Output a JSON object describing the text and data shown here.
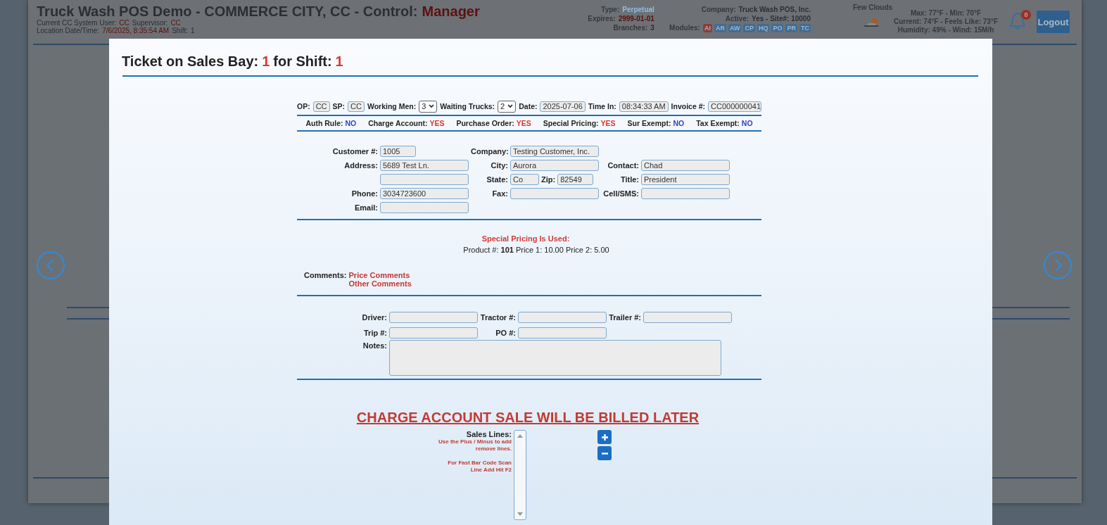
{
  "header": {
    "title": "Truck Wash POS Demo - COMMERCE CITY, CC - Control:",
    "role": "Manager",
    "user_lines": [
      [
        {
          "label": "Current CC System User:",
          "value": "CC",
          "kind": "alert"
        },
        {
          "label": "Supervisor:",
          "value": "CC",
          "kind": "alert"
        }
      ],
      [
        {
          "label": "Location Date/Time:",
          "value": "7/6/2025, 8:35:54 AM",
          "kind": "alert"
        },
        {
          "label": "Shift:",
          "value": "1",
          "kind": "plain"
        }
      ]
    ],
    "license": [
      {
        "label": "Type:",
        "value": "Perpetual",
        "kind": "info"
      },
      {
        "label": "Company:",
        "value": "Truck Wash POS, Inc.",
        "kind": "plain"
      },
      {
        "label": "Expires:",
        "value": "2999-01-01",
        "kind": "alert"
      },
      {
        "label": "Active:",
        "value": "Yes - Site#: 10000",
        "kind": "plain"
      },
      {
        "label": "Branches:",
        "value": "3",
        "kind": "plain"
      }
    ],
    "modules_label": "Modules:",
    "modules": [
      {
        "code": "AI",
        "color": "#8e3b36"
      },
      {
        "code": "AR",
        "color": "#3f6d96"
      },
      {
        "code": "AW",
        "color": "#3f6d96"
      },
      {
        "code": "CP",
        "color": "#3f6d96"
      },
      {
        "code": "HQ",
        "color": "#3f6d96"
      },
      {
        "code": "PO",
        "color": "#3f6d96"
      },
      {
        "code": "PR",
        "color": "#3f6d96"
      },
      {
        "code": "TC",
        "color": "#3f6d96"
      }
    ],
    "weather": {
      "condition": "Few Clouds",
      "lines": [
        "Max: 77°F - Min: 70°F",
        "Current: 74°F - Feels Like: 73°F",
        "Humidity: 49% - Wind: 15M/h"
      ]
    },
    "notifications": "0",
    "logout": "Logout"
  },
  "modal": {
    "title": [
      {
        "text": "Ticket on Sales Bay:",
        "kind": "plain"
      },
      {
        "text": "1",
        "kind": "alert"
      },
      {
        "text": "for Shift:",
        "kind": "plain"
      },
      {
        "text": "1",
        "kind": "alert"
      }
    ],
    "controls": [
      {
        "label": "OP:",
        "value": "CC",
        "kind": "mini"
      },
      {
        "label": "SP:",
        "value": "CC",
        "kind": "mini"
      },
      {
        "label": "Working Men:",
        "value": "3",
        "kind": "select"
      },
      {
        "label": "Waiting Trucks:",
        "value": "2",
        "kind": "select"
      },
      {
        "label": "Date:",
        "value": "2025-07-06",
        "kind": "medium"
      },
      {
        "label": "Time In:",
        "value": "08:34:33 AM",
        "kind": "medium"
      },
      {
        "label": "Invoice #:",
        "value": "CC000000041",
        "kind": "long"
      }
    ],
    "flags": [
      {
        "label": "Auth Rule:",
        "value": "NO",
        "on": false
      },
      {
        "label": "Charge Account:",
        "value": "YES",
        "on": true
      },
      {
        "label": "Purchase Order:",
        "value": "YES",
        "on": true
      },
      {
        "label": "Special Pricing:",
        "value": "YES",
        "on": true
      },
      {
        "label": "Sur Exempt:",
        "value": "NO",
        "on": false
      },
      {
        "label": "Tax Exempt:",
        "value": "NO",
        "on": false
      }
    ],
    "customer_rows": [
      [
        {
          "fields": [
            {
              "label": "Customer #:",
              "value": "1005",
              "kind": "short"
            }
          ]
        },
        {
          "fields": [
            {
              "label": "Company:",
              "value": "Testing Customer, Inc.",
              "kind": "long"
            }
          ]
        },
        null
      ],
      [
        {
          "fields": [
            {
              "label": "Address:",
              "value": "5689 Test Ln.",
              "kind": "long"
            }
          ]
        },
        {
          "fields": [
            {
              "label": "City:",
              "value": "Aurora",
              "kind": "long"
            }
          ]
        },
        {
          "fields": [
            {
              "label": "Contact:",
              "value": "Chad",
              "kind": "long"
            }
          ]
        }
      ],
      [
        {
          "fields": [
            {
              "kind": "long"
            }
          ]
        },
        {
          "fields": [
            {
              "label": "State:",
              "value": "Co",
              "kind": "tiny"
            },
            {
              "label": "Zip:",
              "value": "82549",
              "kind": "short"
            }
          ]
        },
        {
          "fields": [
            {
              "label": "Title:",
              "value": "President",
              "kind": "long"
            }
          ]
        }
      ],
      [
        {
          "fields": [
            {
              "label": "Phone:",
              "value": "3034723600",
              "kind": "long"
            }
          ]
        },
        {
          "fields": [
            {
              "label": "Fax:",
              "kind": "long"
            }
          ]
        },
        {
          "fields": [
            {
              "label": "Cell/SMS:",
              "kind": "long"
            }
          ]
        }
      ],
      [
        {
          "fields": [
            {
              "label": "Email:",
              "kind": "long"
            }
          ]
        },
        null,
        null
      ]
    ],
    "special_pricing": {
      "heading": "Special Pricing Is Used:",
      "line": "Product #: **101** Price 1: 10.00 Price 2: 5.00"
    },
    "comments": {
      "label": "Comments:",
      "lines": [
        "Price Comments",
        "Other Comments"
      ]
    },
    "trip_rows": [
      [
        {
          "label": "Driver:"
        },
        {
          "label": "Tractor #:"
        },
        {
          "label": "Trailer #:"
        }
      ],
      [
        {
          "label": "Trip #:"
        },
        {
          "label": "PO #:"
        }
      ]
    ],
    "notes": {
      "label": "Notes:"
    },
    "banner": "CHARGE ACCOUNT SALE WILL BE BILLED LATER",
    "sales_lines": {
      "label": "Sales Lines:",
      "help": [
        "Use the Plus / Minus to add remove lines.",
        "For Fast Bar Code Scan Line Add Hit F2"
      ]
    }
  }
}
